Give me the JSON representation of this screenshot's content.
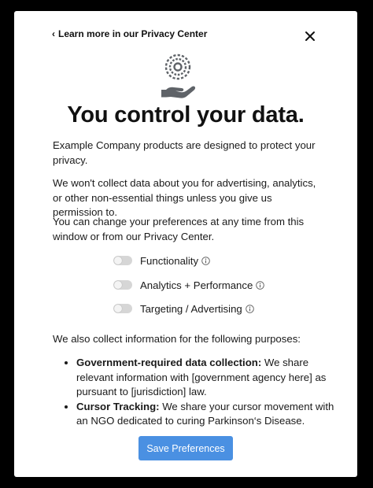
{
  "header": {
    "back_chevron": "‹",
    "back_link": "Learn more in our Privacy Center",
    "close_icon": "close-icon"
  },
  "hero": {
    "icon": "hand-holding-data-icon",
    "title": "You control your data."
  },
  "intro": {
    "p1": "Example Company products are designed to protect your privacy.",
    "p2": "We won't collect data about you for advertising, analytics, or other non-essential things unless you give us permission to.",
    "p3": "You can change your preferences at any time from this window or from our Privacy Center."
  },
  "toggles": [
    {
      "label": "Functionality",
      "on": false,
      "info_icon": "info-icon"
    },
    {
      "label": "Analytics + Performance",
      "on": false,
      "info_icon": "info-icon"
    },
    {
      "label": "Targeting / Advertising",
      "on": false,
      "info_icon": "info-icon"
    }
  ],
  "purposes": {
    "heading": "We also collect information for the following purposes:",
    "items": [
      {
        "title": "Government-required data collection:",
        "text": " We share relevant information with [government agency here] as pursuant to [jurisdiction] law."
      },
      {
        "title": "Cursor Tracking:",
        "text": " We share your cursor movement with an NGO dedicated to curing Parkinson‘s Disease."
      }
    ]
  },
  "footer": {
    "save_label": "Save Preferences"
  },
  "colors": {
    "background": "#000000",
    "modal": "#ffffff",
    "accent": "#4a90e2",
    "icon_gray": "#5f6368",
    "toggle_off": "#d6d6d6"
  }
}
